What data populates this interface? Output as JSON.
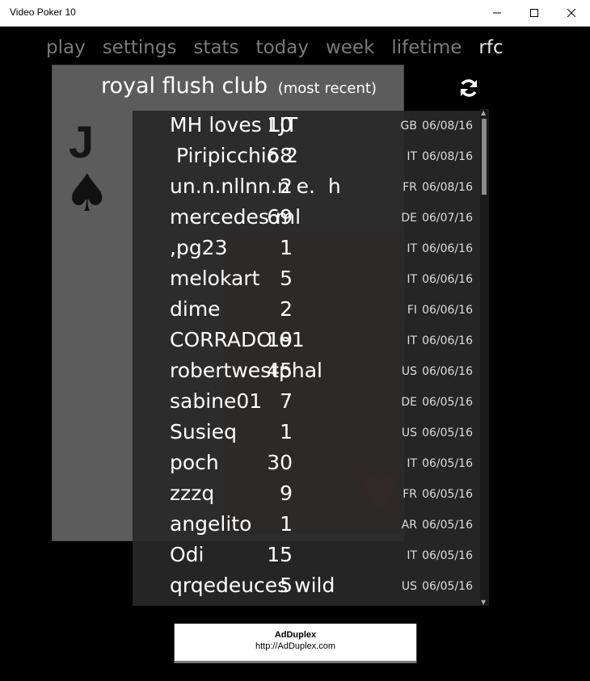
{
  "window": {
    "title": "Video Poker 10"
  },
  "nav": {
    "items": [
      "play",
      "settings",
      "stats",
      "today",
      "week",
      "lifetime",
      "rfc"
    ],
    "active": "rfc"
  },
  "heading": {
    "title": "royal flush club",
    "subtitle": "(most recent)"
  },
  "entries": [
    {
      "count": "10",
      "name": "MH loves LJT",
      "country": "GB",
      "date": "06/08/16"
    },
    {
      "count": "68",
      "name": " Piripicchio 2",
      "country": "IT",
      "date": "06/08/16"
    },
    {
      "count": "2",
      "name": "un.n.nllnn.n e.  h",
      "country": "FR",
      "date": "06/08/16"
    },
    {
      "count": "69",
      "name": "mercedes ml",
      "country": "DE",
      "date": "06/07/16"
    },
    {
      "count": "1",
      "name": ",pg23",
      "country": "IT",
      "date": "06/06/16"
    },
    {
      "count": "5",
      "name": "melokart",
      "country": "IT",
      "date": "06/06/16"
    },
    {
      "count": "2",
      "name": "dime",
      "country": "FI",
      "date": "06/06/16"
    },
    {
      "count": "19",
      "name": "CORRADO 61",
      "country": "IT",
      "date": "06/06/16"
    },
    {
      "count": "45",
      "name": "robertwestphal",
      "country": "US",
      "date": "06/06/16"
    },
    {
      "count": "7",
      "name": "sabine01",
      "country": "DE",
      "date": "06/05/16"
    },
    {
      "count": "1",
      "name": "Susieq",
      "country": "US",
      "date": "06/05/16"
    },
    {
      "count": "30",
      "name": "poch",
      "country": "IT",
      "date": "06/05/16"
    },
    {
      "count": "9",
      "name": "zzzq",
      "country": "FR",
      "date": "06/05/16"
    },
    {
      "count": "1",
      "name": "angelito",
      "country": "AR",
      "date": "06/05/16"
    },
    {
      "count": "15",
      "name": "Odi",
      "country": "IT",
      "date": "06/05/16"
    },
    {
      "count": "5",
      "name": "qrqedeuces wild",
      "country": "US",
      "date": "06/05/16"
    }
  ],
  "ad": {
    "brand": "AdDuplex",
    "url": "http://AdDuplex.com"
  },
  "icons": {
    "refresh": "refresh-icon",
    "minimize": "minimize-icon",
    "maximize": "maximize-icon",
    "close": "close-icon"
  },
  "colors": {
    "background": "#000000",
    "nav_inactive": "#7a7a7a",
    "nav_active": "#e8e8e8",
    "panel": "#282828"
  }
}
